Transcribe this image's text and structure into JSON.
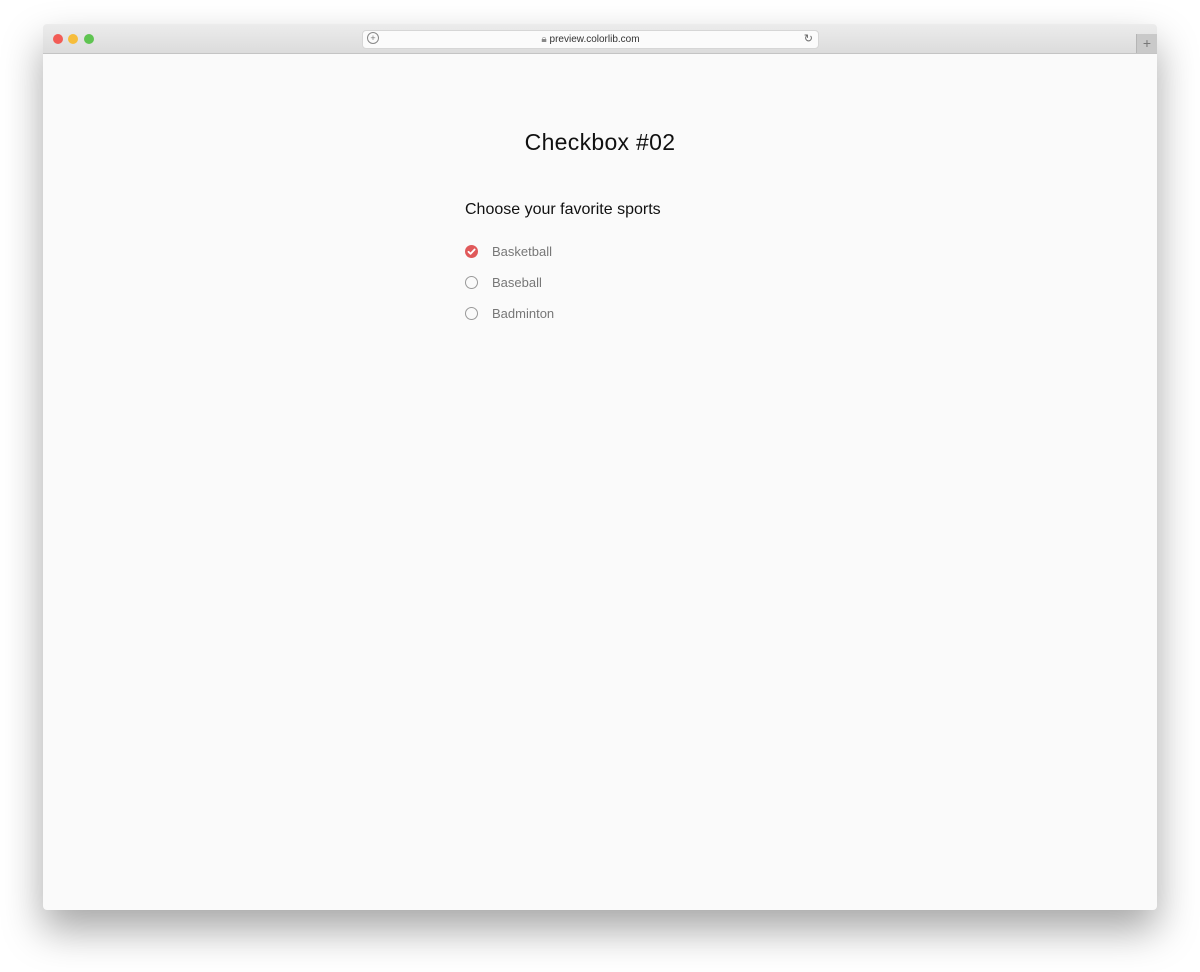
{
  "browser": {
    "url": "preview.colorlib.com",
    "new_tab_label": "+"
  },
  "page": {
    "title": "Checkbox #02",
    "question": "Choose your favorite sports",
    "accent_color": "#e0595a",
    "options": [
      {
        "label": "Basketball",
        "checked": true
      },
      {
        "label": "Baseball",
        "checked": false
      },
      {
        "label": "Badminton",
        "checked": false
      }
    ]
  }
}
